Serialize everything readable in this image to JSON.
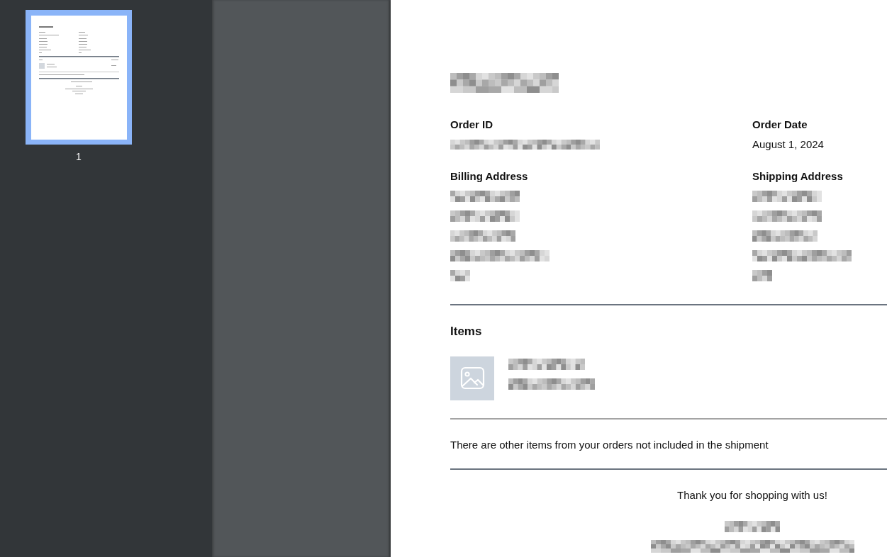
{
  "sidebar": {
    "thumbnails": [
      {
        "page_number": "1",
        "selected": true
      }
    ]
  },
  "page": {
    "title": {
      "kind": "pixelated"
    },
    "details": [
      {
        "label": "Order ID",
        "lines": [
          {
            "kind": "pixelated"
          }
        ]
      },
      {
        "label": "Order Date",
        "lines": [
          {
            "kind": "text",
            "text": "August 1, 2024"
          }
        ]
      },
      {
        "label": "Billing Address",
        "lines": [
          {
            "kind": "pixelated"
          },
          {
            "kind": "pixelated"
          },
          {
            "kind": "pixelated"
          },
          {
            "kind": "pixelated"
          },
          {
            "kind": "pixelated"
          }
        ]
      },
      {
        "label": "Shipping Address",
        "lines": [
          {
            "kind": "pixelated"
          },
          {
            "kind": "pixelated"
          },
          {
            "kind": "pixelated"
          },
          {
            "kind": "pixelated"
          },
          {
            "kind": "pixelated"
          }
        ]
      }
    ],
    "items": {
      "heading": "Items",
      "rows": [
        {
          "name": {
            "kind": "pixelated"
          },
          "detail": {
            "kind": "pixelated"
          }
        }
      ]
    },
    "notice": "There are other items from your orders not included in the shipment",
    "footer": {
      "message": "Thank you for shopping with us!",
      "store_name": {
        "kind": "pixelated"
      },
      "store_address": {
        "kind": "pixelated"
      }
    }
  }
}
